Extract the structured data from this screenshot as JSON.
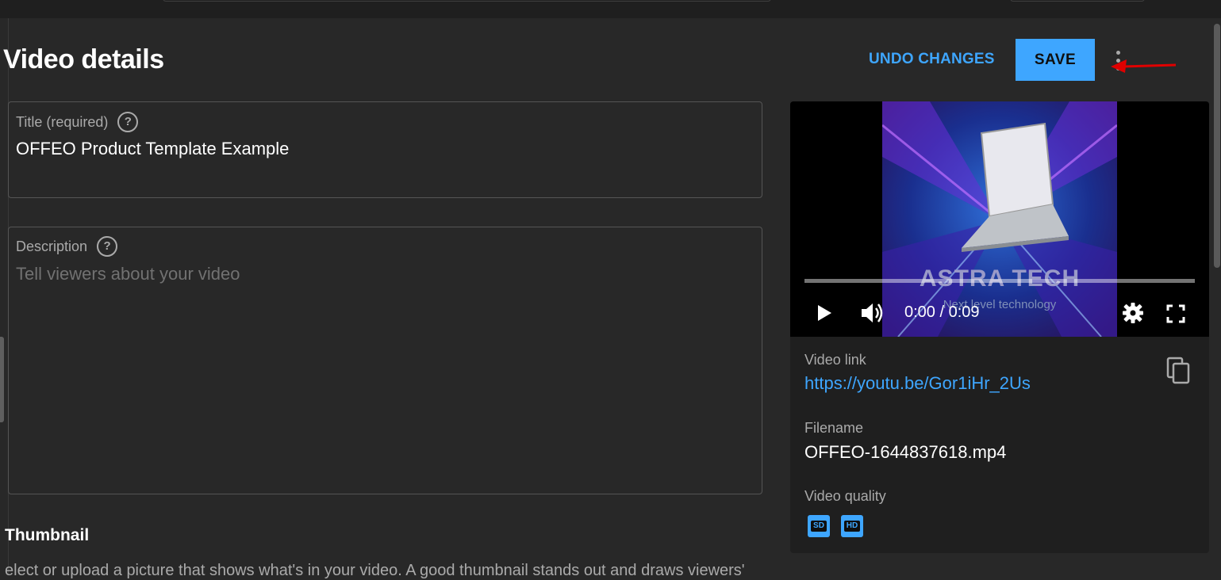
{
  "page": {
    "title": "Video details"
  },
  "header": {
    "undo_label": "UNDO CHANGES",
    "save_label": "SAVE"
  },
  "form": {
    "title": {
      "label": "Title (required)",
      "value": "OFFEO Product Template Example"
    },
    "description": {
      "label": "Description",
      "placeholder": "Tell viewers about your video",
      "value": ""
    }
  },
  "thumbnail": {
    "heading": "Thumbnail",
    "description": "elect or upload a picture that shows what's in your video. A good thumbnail stands out and draws viewers'"
  },
  "player": {
    "time": "0:00 / 0:09",
    "preview_brand": "ASTRA TECH",
    "preview_tagline": "Next level technology",
    "progress": 0
  },
  "info": {
    "link_label": "Video link",
    "link_value": "https://youtu.be/Gor1iHr_2Us",
    "filename_label": "Filename",
    "filename_value": "OFFEO-1644837618.mp4",
    "quality_label": "Video quality",
    "quality_badges": [
      "SD",
      "HD"
    ]
  },
  "colors": {
    "background": "#282828",
    "accent": "#3ea6ff",
    "annotation_arrow": "#e00000"
  },
  "icons": [
    "help-icon",
    "more-vert-icon",
    "play-icon",
    "volume-icon",
    "settings-gear-icon",
    "fullscreen-icon",
    "copy-icon",
    "red-arrow-annotation"
  ]
}
